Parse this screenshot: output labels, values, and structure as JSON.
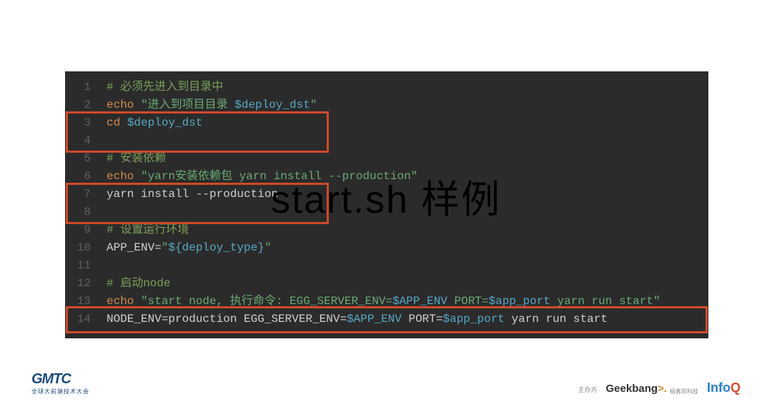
{
  "overlay_title": "start.sh 样例",
  "code": {
    "lines": [
      {
        "n": "1",
        "segs": [
          {
            "cls": "comment",
            "t": "# 必须先进入到目录中"
          }
        ]
      },
      {
        "n": "2",
        "segs": [
          {
            "cls": "cmd",
            "t": "echo"
          },
          {
            "cls": "plain",
            "t": " "
          },
          {
            "cls": "str",
            "t": "\"进入到项目目录 "
          },
          {
            "cls": "var",
            "t": "$deploy_dst"
          },
          {
            "cls": "str",
            "t": "\""
          }
        ]
      },
      {
        "n": "3",
        "segs": [
          {
            "cls": "cmd",
            "t": "cd"
          },
          {
            "cls": "plain",
            "t": " "
          },
          {
            "cls": "var",
            "t": "$deploy_dst"
          }
        ]
      },
      {
        "n": "4",
        "segs": [
          {
            "cls": "plain",
            "t": ""
          }
        ]
      },
      {
        "n": "5",
        "segs": [
          {
            "cls": "comment",
            "t": "# 安装依赖"
          }
        ]
      },
      {
        "n": "6",
        "segs": [
          {
            "cls": "cmd",
            "t": "echo"
          },
          {
            "cls": "plain",
            "t": " "
          },
          {
            "cls": "str",
            "t": "\"yarn安装依赖包 yarn install --production\""
          }
        ]
      },
      {
        "n": "7",
        "segs": [
          {
            "cls": "plain",
            "t": "yarn install --production"
          }
        ]
      },
      {
        "n": "8",
        "segs": [
          {
            "cls": "plain",
            "t": ""
          }
        ]
      },
      {
        "n": "9",
        "segs": [
          {
            "cls": "comment",
            "t": "# 设置运行环境"
          }
        ]
      },
      {
        "n": "10",
        "segs": [
          {
            "cls": "plain",
            "t": "APP_ENV="
          },
          {
            "cls": "str",
            "t": "\""
          },
          {
            "cls": "var",
            "t": "${deploy_type}"
          },
          {
            "cls": "str",
            "t": "\""
          }
        ]
      },
      {
        "n": "11",
        "segs": [
          {
            "cls": "plain",
            "t": ""
          }
        ]
      },
      {
        "n": "12",
        "segs": [
          {
            "cls": "comment",
            "t": "# 启动node"
          }
        ]
      },
      {
        "n": "13",
        "segs": [
          {
            "cls": "cmd",
            "t": "echo"
          },
          {
            "cls": "plain",
            "t": " "
          },
          {
            "cls": "str",
            "t": "\"start node, 执行命令: EGG_SERVER_ENV="
          },
          {
            "cls": "var",
            "t": "$APP_ENV"
          },
          {
            "cls": "str",
            "t": " PORT="
          },
          {
            "cls": "var",
            "t": "$app_port"
          },
          {
            "cls": "str",
            "t": " yarn run start\""
          }
        ]
      },
      {
        "n": "14",
        "segs": [
          {
            "cls": "plain",
            "t": "NODE_ENV=production EGG_SERVER_ENV="
          },
          {
            "cls": "var",
            "t": "$APP_ENV"
          },
          {
            "cls": "plain",
            "t": " PORT="
          },
          {
            "cls": "var",
            "t": "$app_port"
          },
          {
            "cls": "plain",
            "t": " yarn run start"
          }
        ]
      }
    ]
  },
  "footer": {
    "gmtc": "GMTC",
    "gmtc_sub": "全球大前端技术大会",
    "zhuban": "主办方",
    "geekbang": "Geekbang",
    "geekbang_sub": "极客邦科技",
    "infoq_info": "Info",
    "infoq_q": "Q"
  }
}
